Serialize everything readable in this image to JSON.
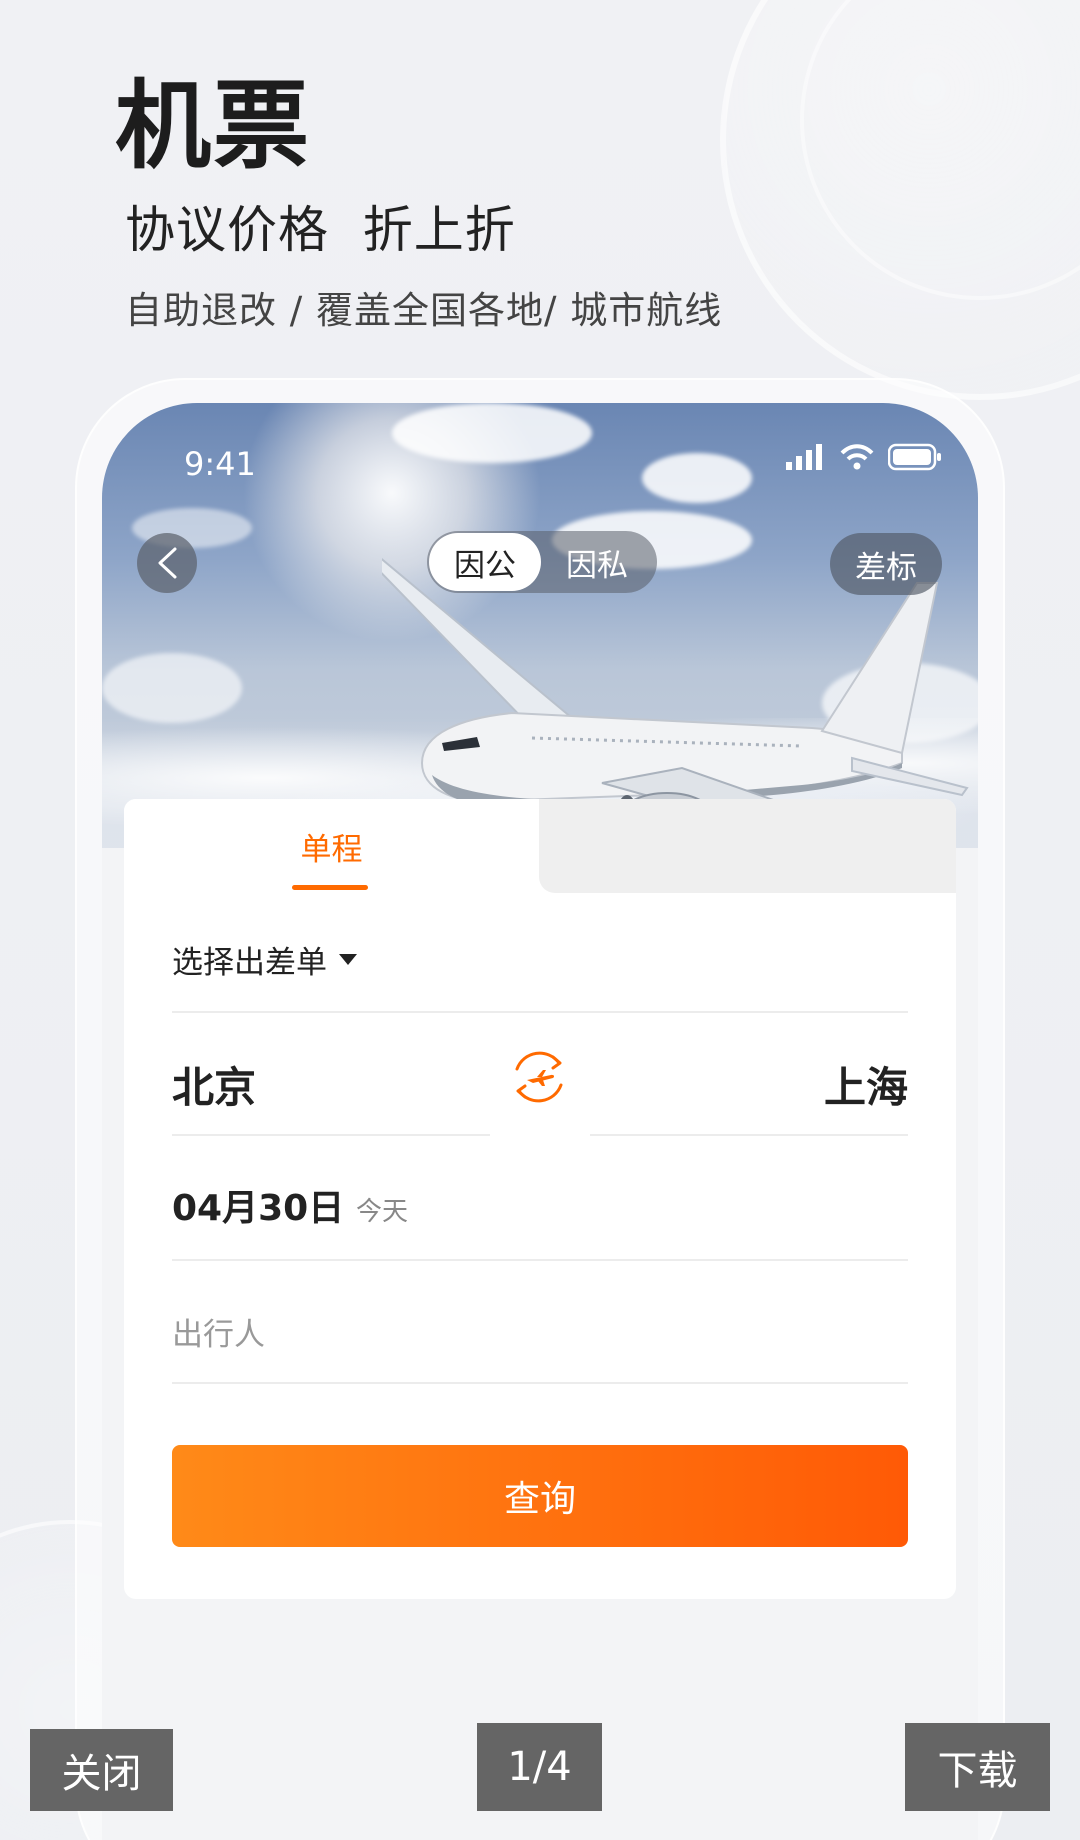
{
  "hero": {
    "title": "机票",
    "subtitle": "协议价格  折上折",
    "description": "自助退改 / 覆盖全国各地/ 城市航线"
  },
  "status_bar": {
    "time": "9:41"
  },
  "header": {
    "toggle": {
      "business": "因公",
      "private": "因私",
      "selected": "因公"
    },
    "standard_label": "差标"
  },
  "tabs": [
    {
      "label": "单程",
      "active": true
    },
    {
      "label": "",
      "active": false
    }
  ],
  "form": {
    "trip_selector": "选择出差单",
    "from_city": "北京",
    "to_city": "上海",
    "date": "04月30日",
    "date_note": "今天",
    "traveler_placeholder": "出行人",
    "search_label": "查询"
  },
  "bottom": {
    "close_label": "关闭",
    "page_indicator": "1/4",
    "download_label": "下载"
  },
  "colors": {
    "accent": "#ff6a00",
    "button_gradient_start": "#ff8a18",
    "button_gradient_end": "#ff5a06"
  }
}
